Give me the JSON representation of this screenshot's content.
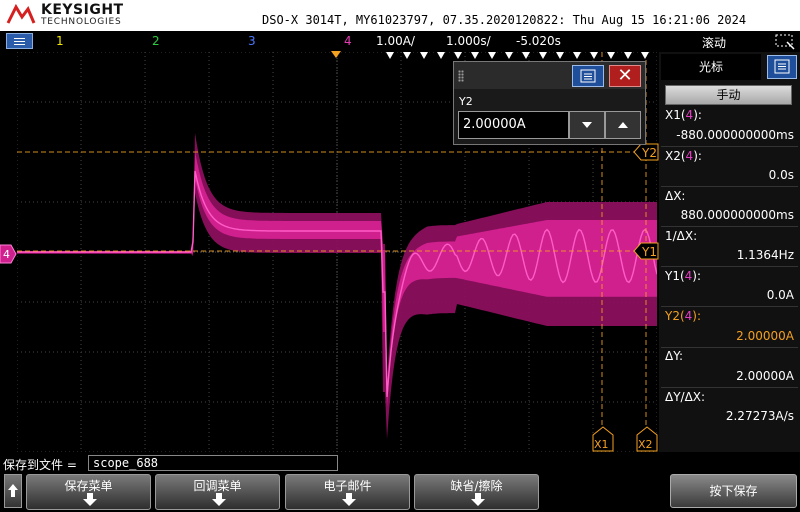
{
  "header": {
    "brand": "KEYSIGHT",
    "brand_sub": "TECHNOLOGIES",
    "device_info": "DSO-X 3014T, MY61023797, 07.35.2020120822: Thu Aug 15 16:21:06 2024"
  },
  "statusbar": {
    "ch1": "1",
    "ch2": "2",
    "ch3": "3",
    "ch4": "4",
    "ch4_scale": "1.00A/",
    "time_scale": "1.000s/",
    "delay": "-5.020s",
    "mode": "滚动",
    "colors": {
      "ch1": "#f2e600",
      "ch2": "#2ecc40",
      "ch3": "#4a78ff",
      "ch4": "#e53bb5"
    }
  },
  "scope": {
    "y2_marker": "Y2",
    "y1_marker": "Y1",
    "x1_marker": "X1",
    "x2_marker": "X2",
    "ground_marker": "4",
    "trace_color": "#e0219f",
    "cursor_color": "#f4a020"
  },
  "y2_panel": {
    "label": "Y2",
    "value": "2.00000A"
  },
  "cursor_panel": {
    "tab": "光标",
    "mode_button": "手动",
    "x1_label_pre": "X1(",
    "x1_ch": "4",
    "label_post": "):",
    "x1_value": "-880.000000000ms",
    "x2_label_pre": "X2(",
    "x2_ch": "4",
    "x2_value": "0.0s",
    "dx_label": "ΔX:",
    "dx_value": "880.000000000ms",
    "inv_dx_label": "1/ΔX:",
    "inv_dx_value": "1.1364Hz",
    "y1_label_pre": "Y1(",
    "y1_ch": "4",
    "y1_value": "0.0A",
    "y2_label_pre": "Y2(",
    "y2_ch": "4",
    "y2_value": "2.00000A",
    "dy_label": "ΔY:",
    "dy_value": "2.00000A",
    "dydx_label": "ΔY/ΔX:",
    "dydx_value": "2.27273A/s"
  },
  "bottom": {
    "save_label": "保存到文件 =",
    "file_name": "scope_688",
    "softkeys": [
      "保存菜单",
      "回调菜单",
      "电子邮件",
      "缺省/擦除"
    ],
    "press_save": "按下保存"
  }
}
